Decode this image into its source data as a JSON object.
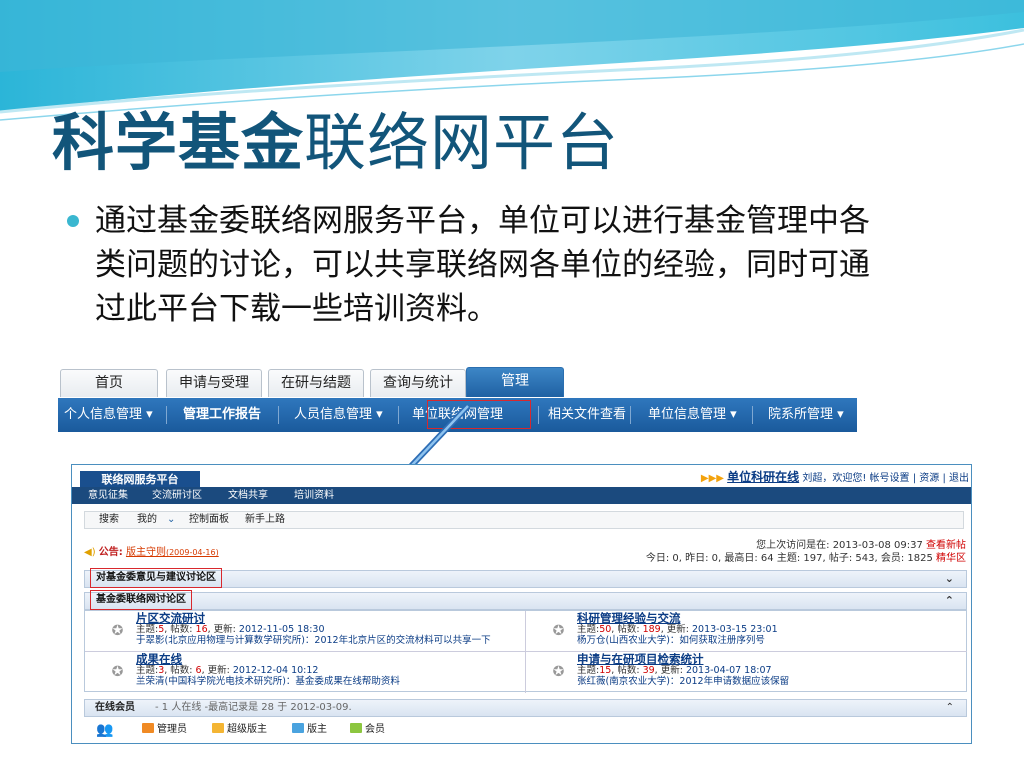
{
  "slide": {
    "title_bold": "科学基金",
    "title_rest": "联络网平台",
    "bullet": "通过基金委联络网服务平台，单位可以进行基金管理中各类问题的讨论，可以共享联络网各单位的经验，同时可通过此平台下载一些培训资料。"
  },
  "system": {
    "tabs": [
      "首页",
      "申请与受理",
      "在研与结题",
      "查询与统计",
      "管理"
    ],
    "active_tab": "管理",
    "subnav": [
      "个人信息管理 ▾",
      "管理工作报告",
      "人员信息管理 ▾",
      "单位联络网管理",
      "相关文件查看",
      "单位信息管理 ▾",
      "院系所管理 ▾"
    ],
    "highlighted": "单位联络网管理"
  },
  "forum": {
    "tab": "联络网服务平台",
    "top_arrows": "▶▶▶",
    "top_link": "单位科研在线",
    "top_user": "刘超，欢迎您!",
    "top_links": "帐号设置 | 资源 | 退出",
    "nav": [
      "意见征集",
      "交流研讨区",
      "文档共享",
      "培训资料"
    ],
    "menu": [
      "搜索",
      "我的",
      "控制面板",
      "新手上路"
    ],
    "notice_label": "公告:",
    "notice_rule": "版主守则",
    "notice_date": "(2009-04-16)",
    "last_visit": "您上次访问是在: 2013-03-08 09:37",
    "view_new": "查看新帖",
    "stats": "今日: 0, 昨日: 0, 最高日: 64 主题: 197, 帖子: 543, 会员: 1825",
    "stats_link": "精华区",
    "section1": "对基金委意见与建议讨论区",
    "section2": "基金委联络网讨论区",
    "boards": [
      {
        "name": "片区交流研讨",
        "topics": "5",
        "posts": "16",
        "updated": "2012-11-05 18:30",
        "latest": "于翠影(北京应用物理与计算数学研究所)：2012年北京片区的交流材料可以共享一下"
      },
      {
        "name": "科研管理经验与交流",
        "topics": "50",
        "posts": "189",
        "updated": "2013-03-15 23:01",
        "latest": "杨万仓(山西农业大学)：如何获取注册序列号"
      },
      {
        "name": "成果在线",
        "topics": "3",
        "posts": "6",
        "updated": "2012-12-04 10:12",
        "latest": "兰荣清(中国科学院光电技术研究所)：基金委成果在线帮助资料"
      },
      {
        "name": "申请与在研项目检索统计",
        "topics": "15",
        "posts": "39",
        "updated": "2013-04-07 18:07",
        "latest": "张红薇(南京农业大学)：2012年申请数据应该保留"
      }
    ],
    "labels": {
      "topic": "主题:",
      "post": "帖数:",
      "update": "更新:"
    },
    "online_title": "在线会员",
    "online_info": "- 1 人在线 -最高记录是 28 于 2012-03-09.",
    "legend": [
      "管理员",
      "超级版主",
      "版主",
      "会员"
    ]
  },
  "colors": {
    "title": "#12557a",
    "accent": "#3ab7d0",
    "nav_blue": "#1f61a3",
    "highlight": "#d8282d"
  }
}
